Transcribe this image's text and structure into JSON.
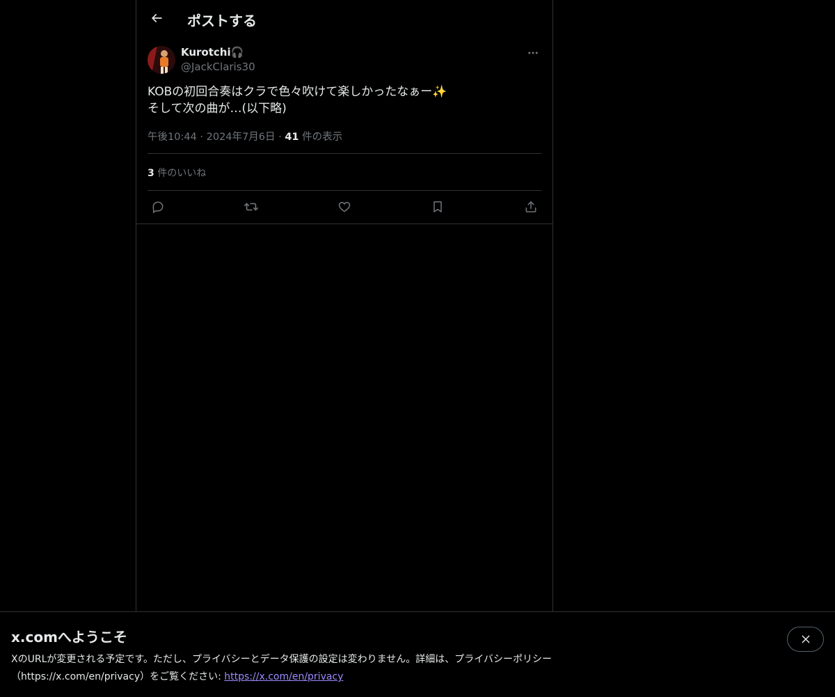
{
  "header": {
    "title": "ポストする"
  },
  "post": {
    "display_name": "Kurotchi🎧",
    "handle": "@JackClaris30",
    "text": "KOBの初回合奏はクラで色々吹けて楽しかったなぁー✨\nそして次の曲が…(以下略)",
    "time": "午後10:44",
    "date": "2024年7月6日",
    "separator": "·",
    "views_count": "41",
    "views_label": "件の表示",
    "likes_count": "3",
    "likes_label": "件のいいね"
  },
  "icons": {
    "back": "arrow-left-icon",
    "more": "more-horizontal-icon",
    "reply": "reply-icon",
    "repost": "repost-icon",
    "like": "heart-icon",
    "bookmark": "bookmark-icon",
    "share": "share-icon",
    "close": "close-icon"
  },
  "banner": {
    "title": "x.comへようこそ",
    "text": "XのURLが変更される予定です。ただし、プライバシーとデータ保護の設定は変わりません。詳細は、プライバシーポリシー（https://x.com/en/privacy）をご覧ください: ",
    "link": "https://x.com/en/privacy"
  },
  "colors": {
    "background": "#000000",
    "text": "#e7e9ea",
    "muted": "#71767b",
    "link": "#9b8cff",
    "border": "#2f3336"
  }
}
